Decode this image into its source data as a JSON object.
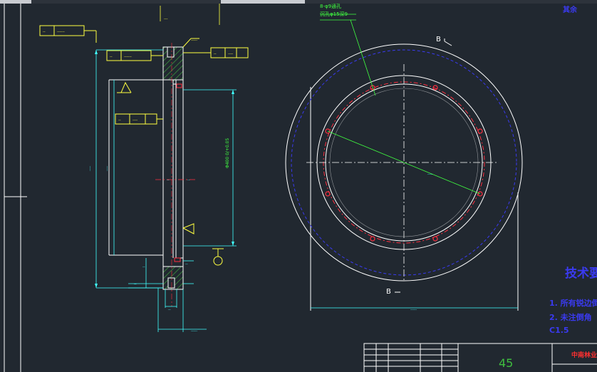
{
  "toolbar": {
    "tabs": [
      {
        "label": ""
      },
      {
        "label": ""
      }
    ]
  },
  "drawing": {
    "section_marker_top": "B",
    "section_marker_bottom": "B",
    "hole_note_line1": "8-φ9通孔",
    "hole_note_line2": "沉孔φ15深9",
    "tech_requirements_title": "技术要",
    "tech_requirements_lines": [
      "1. 所有锐边倒",
      "2. 未注倒角",
      "C1.5"
    ],
    "corner_text": "其余",
    "dim_bore": "Φ400 0/+0.05",
    "colors": {
      "background": "#212830",
      "outline": "#ffffff",
      "dimension": "#40ffff",
      "note": "#40ff40",
      "leader": "#ffff40",
      "hatch": "#3fa63f",
      "hole": "#ff3040",
      "hidden_circle": "#3a3af0",
      "center_line": "#ff3040",
      "title_text": "#3a3af0"
    }
  },
  "title_block": {
    "sheet_number": "45",
    "company": "中南林业"
  }
}
